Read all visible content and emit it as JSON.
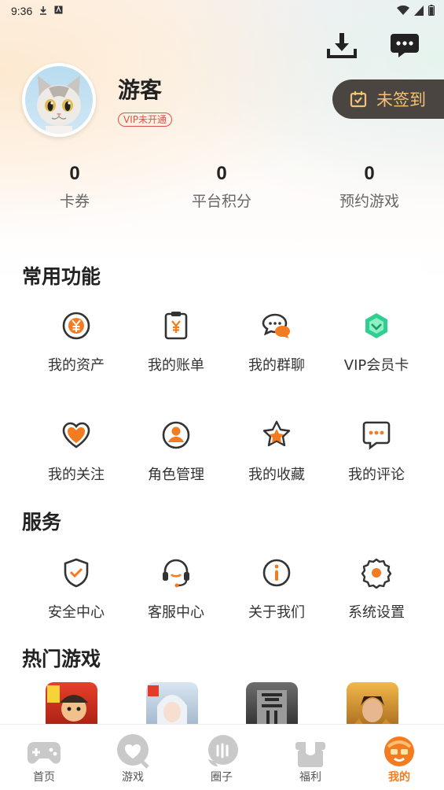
{
  "status_bar": {
    "time": "9:36"
  },
  "profile": {
    "username": "游客",
    "vip_status": "VIP未开通",
    "checkin_label": "未签到"
  },
  "stats": [
    {
      "value": "0",
      "label": "卡券"
    },
    {
      "value": "0",
      "label": "平台积分"
    },
    {
      "value": "0",
      "label": "预约游戏"
    }
  ],
  "common_functions": {
    "title": "常用功能",
    "items": [
      {
        "label": "我的资产",
        "icon": "yen-coin-icon"
      },
      {
        "label": "我的账单",
        "icon": "bill-icon"
      },
      {
        "label": "我的群聊",
        "icon": "group-chat-icon"
      },
      {
        "label": "VIP会员卡",
        "icon": "vip-card-icon"
      },
      {
        "label": "我的关注",
        "icon": "heart-follow-icon"
      },
      {
        "label": "角色管理",
        "icon": "role-user-icon"
      },
      {
        "label": "我的收藏",
        "icon": "star-favorite-icon"
      },
      {
        "label": "我的评论",
        "icon": "comment-icon"
      }
    ]
  },
  "services": {
    "title": "服务",
    "items": [
      {
        "label": "安全中心",
        "icon": "shield-icon"
      },
      {
        "label": "客服中心",
        "icon": "headset-icon"
      },
      {
        "label": "关于我们",
        "icon": "info-icon"
      },
      {
        "label": "系统设置",
        "icon": "settings-icon"
      }
    ]
  },
  "hot_games": {
    "title": "热门游戏"
  },
  "tabbar": {
    "items": [
      {
        "label": "首页",
        "icon": "gamepad-icon"
      },
      {
        "label": "游戏",
        "icon": "game-heart-icon"
      },
      {
        "label": "圈子",
        "icon": "circle-chat-icon"
      },
      {
        "label": "福利",
        "icon": "gift-icon"
      },
      {
        "label": "我的",
        "icon": "me-face-icon"
      }
    ],
    "active_index": 4
  },
  "colors": {
    "accent": "#f47b20",
    "checkin_bg": "#4a4540",
    "checkin_text": "#f3c277",
    "vip_red": "#e0504a",
    "vip_card_green": "#2fcf91"
  }
}
